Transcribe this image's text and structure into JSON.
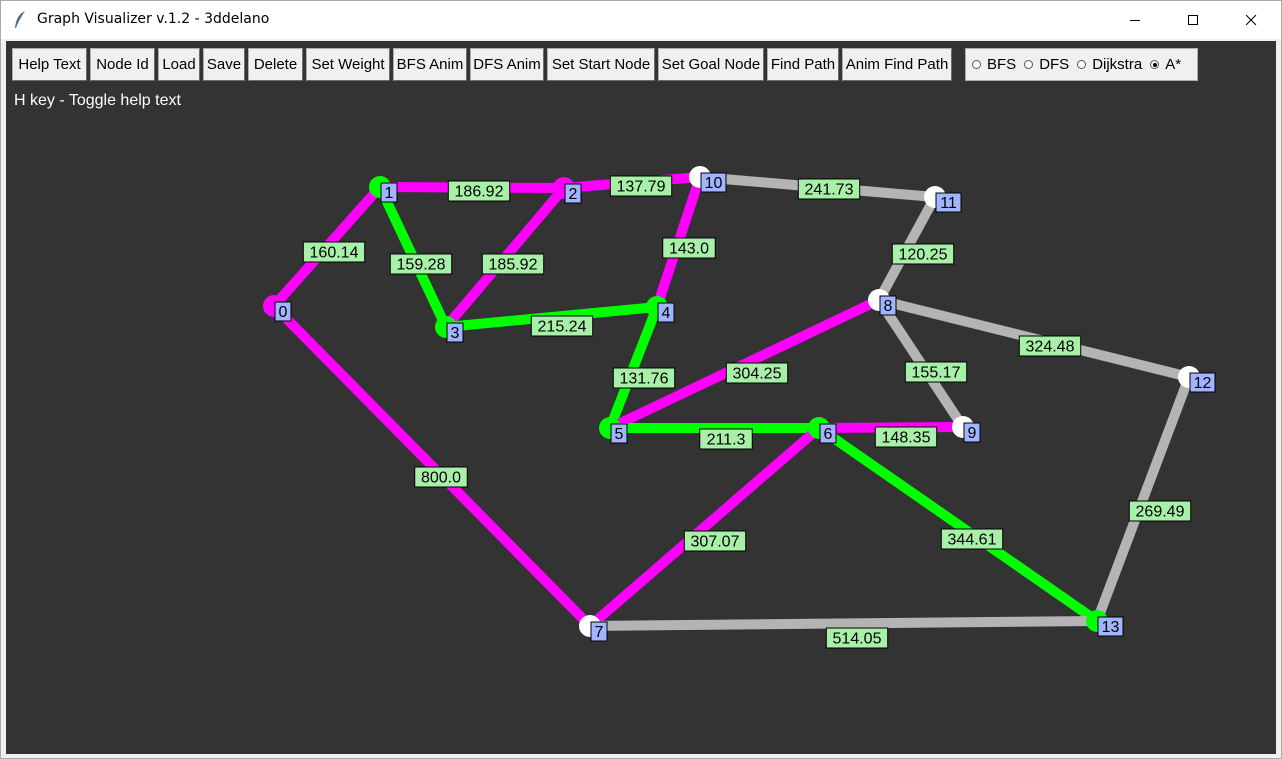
{
  "window": {
    "title": "Graph Visualizer v.1.2 - 3ddelano",
    "minimize_icon": "minimize-icon",
    "maximize_icon": "maximize-icon",
    "close_icon": "close-icon"
  },
  "toolbar": {
    "buttons": [
      "Help Text",
      "Node Id",
      "Load",
      "Save",
      "Delete",
      "Set Weight",
      "BFS Anim",
      "DFS Anim",
      "Set Start Node",
      "Set Goal Node",
      "Find Path",
      "Anim Find Path"
    ],
    "algorithms": [
      {
        "label": "BFS",
        "selected": false
      },
      {
        "label": "DFS",
        "selected": false
      },
      {
        "label": "Dijkstra",
        "selected": false
      },
      {
        "label": "A*",
        "selected": true
      }
    ]
  },
  "help_text": "H key - Toggle help text",
  "colors": {
    "canvas_bg": "#333333",
    "edge_default": "#b4b4b4",
    "edge_path": "#ff00ff",
    "edge_search": "#00ff00",
    "node_default": "#ffffff",
    "weight_label_bg": "#a8f0a8",
    "node_id_bg": "#a0b4ff"
  },
  "graph": {
    "nodes": [
      {
        "id": "0",
        "state": "path"
      },
      {
        "id": "1",
        "state": "search"
      },
      {
        "id": "2",
        "state": "path"
      },
      {
        "id": "3",
        "state": "search"
      },
      {
        "id": "4",
        "state": "search"
      },
      {
        "id": "5",
        "state": "search"
      },
      {
        "id": "6",
        "state": "search"
      },
      {
        "id": "7",
        "state": "default"
      },
      {
        "id": "8",
        "state": "default"
      },
      {
        "id": "9",
        "state": "default"
      },
      {
        "id": "10",
        "state": "default"
      },
      {
        "id": "11",
        "state": "default"
      },
      {
        "id": "12",
        "state": "default"
      },
      {
        "id": "13",
        "state": "search"
      }
    ],
    "edges": [
      {
        "from": "0",
        "to": "1",
        "weight": "160.14",
        "state": "path"
      },
      {
        "from": "1",
        "to": "2",
        "weight": "186.92",
        "state": "path"
      },
      {
        "from": "2",
        "to": "10",
        "weight": "137.79",
        "state": "path"
      },
      {
        "from": "1",
        "to": "3",
        "weight": "159.28",
        "state": "search"
      },
      {
        "from": "2",
        "to": "3",
        "weight": "185.92",
        "state": "path"
      },
      {
        "from": "3",
        "to": "4",
        "weight": "215.24",
        "state": "search"
      },
      {
        "from": "10",
        "to": "4",
        "weight": "143.0",
        "state": "path"
      },
      {
        "from": "10",
        "to": "11",
        "weight": "241.73",
        "state": "default"
      },
      {
        "from": "11",
        "to": "8",
        "weight": "120.25",
        "state": "default"
      },
      {
        "from": "4",
        "to": "5",
        "weight": "131.76",
        "state": "search"
      },
      {
        "from": "5",
        "to": "8",
        "weight": "304.25",
        "state": "path"
      },
      {
        "from": "8",
        "to": "12",
        "weight": "324.48",
        "state": "default"
      },
      {
        "from": "8",
        "to": "9",
        "weight": "155.17",
        "state": "default"
      },
      {
        "from": "5",
        "to": "6",
        "weight": "211.3",
        "state": "search"
      },
      {
        "from": "6",
        "to": "9",
        "weight": "148.35",
        "state": "path"
      },
      {
        "from": "0",
        "to": "7",
        "weight": "800.0",
        "state": "path"
      },
      {
        "from": "6",
        "to": "7",
        "weight": "307.07",
        "state": "path"
      },
      {
        "from": "6",
        "to": "13",
        "weight": "344.61",
        "state": "search"
      },
      {
        "from": "12",
        "to": "13",
        "weight": "269.49",
        "state": "default"
      },
      {
        "from": "7",
        "to": "13",
        "weight": "514.05",
        "state": "default"
      }
    ]
  }
}
